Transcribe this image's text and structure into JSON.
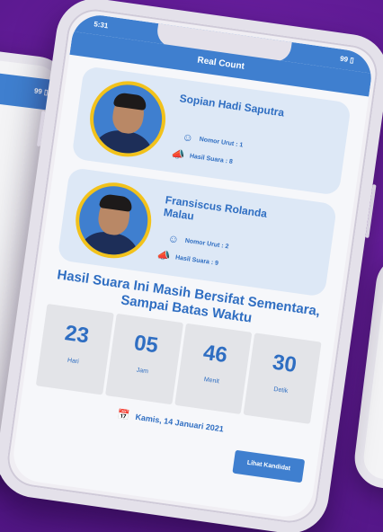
{
  "status_bar": {
    "time": "5:31",
    "battery": "99 ▯"
  },
  "app_bar": {
    "title": "Real Count"
  },
  "candidates": [
    {
      "name": "Sopian Hadi Saputra",
      "nomor_urut": "Nomor Urut : 1",
      "hasil_suara": "Hasil Suara : 8"
    },
    {
      "name": "Fransiscus Rolanda Malau",
      "nomor_urut": "Nomor Urut : 2",
      "hasil_suara": "Hasil Suara : 9"
    }
  ],
  "headline": "Hasil Suara Ini Masih Bersifat Sementara, Sampai Batas Waktu",
  "countdown": [
    {
      "value": "23",
      "unit": "Hari"
    },
    {
      "value": "05",
      "unit": "Jam"
    },
    {
      "value": "46",
      "unit": "Menit"
    },
    {
      "value": "30",
      "unit": "Detik"
    }
  ],
  "date": "Kamis, 14 Januari 2021",
  "button": {
    "label": "Lihat Kandidat"
  },
  "side_phone": {
    "battery": "99 ▯"
  },
  "colors": {
    "accent": "#3f7fcf",
    "card": "#dde8f6",
    "ring": "#f2c21b",
    "background": "#6a1fa0"
  },
  "icons": {
    "nomor": "user-circle-icon",
    "suara": "megaphone-icon",
    "date": "calendar-icon"
  }
}
